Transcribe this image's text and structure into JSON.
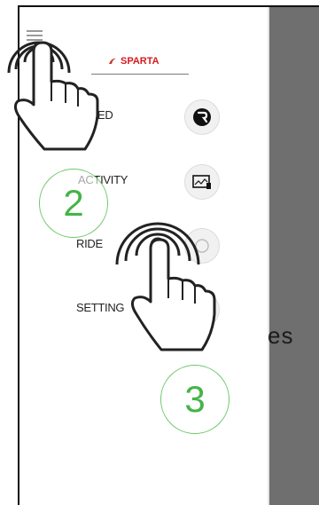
{
  "background_text": "es",
  "brand": {
    "name": "SPARTA",
    "color": "#d71920"
  },
  "menu": [
    {
      "label": "ED",
      "icon": "r-logo-icon"
    },
    {
      "label": "ACTIVITY",
      "icon": "activity-chart-icon"
    },
    {
      "label": "RIDE",
      "icon": "ride-icon"
    },
    {
      "label": "SETTING",
      "icon": "settings-icon"
    }
  ],
  "steps": [
    {
      "number": "2",
      "color": "#45b448"
    },
    {
      "number": "3",
      "color": "#45b448"
    }
  ],
  "overlay_color": "#6f6f6f"
}
